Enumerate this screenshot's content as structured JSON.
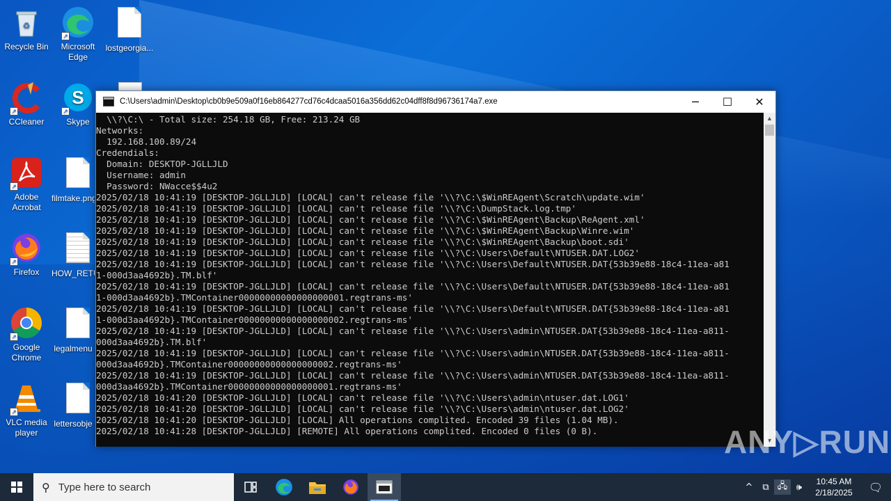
{
  "desktop": {
    "icons": [
      {
        "label": "Recycle Bin",
        "icon": "recycle-bin-icon"
      },
      {
        "label": "Microsoft Edge",
        "icon": "edge-icon"
      },
      {
        "label": "lostgeorgia...",
        "icon": "document-icon"
      },
      {
        "label": "CCleaner",
        "icon": "ccleaner-icon"
      },
      {
        "label": "Skype",
        "icon": "skype-icon"
      },
      {
        "label": "Adobe Acrobat",
        "icon": "acrobat-icon"
      },
      {
        "label": "filmtake.png",
        "icon": "document-icon"
      },
      {
        "label": "Firefox",
        "icon": "firefox-icon"
      },
      {
        "label": "HOW_RETU",
        "icon": "text-document-icon"
      },
      {
        "label": "Google Chrome",
        "icon": "chrome-icon"
      },
      {
        "label": "legalmenu",
        "icon": "document-icon"
      },
      {
        "label": "VLC media player",
        "icon": "vlc-icon"
      },
      {
        "label": "lettersobje",
        "icon": "document-icon"
      }
    ]
  },
  "window": {
    "title": "C:\\Users\\admin\\Desktop\\cb0b9e509a0f16eb864277cd76c4dcaa5016a356dd62c04dff8f8d96736174a7.exe",
    "minimize_glyph": "─",
    "maximize_glyph": "☐",
    "close_glyph": "✕"
  },
  "console": {
    "lines": [
      "  \\\\?\\C:\\ - Total size: 254.18 GB, Free: 213.24 GB",
      "Networks:",
      "  192.168.100.89/24",
      "Credendials:",
      "  Domain: DESKTOP-JGLLJLD",
      "  Username: admin",
      "  Password: NWacce$$4u2",
      "2025/02/18 10:41:19 [DESKTOP-JGLLJLD] [LOCAL] can't release file '\\\\?\\C:\\$WinREAgent\\Scratch\\update.wim'",
      "2025/02/18 10:41:19 [DESKTOP-JGLLJLD] [LOCAL] can't release file '\\\\?\\C:\\DumpStack.log.tmp'",
      "2025/02/18 10:41:19 [DESKTOP-JGLLJLD] [LOCAL] can't release file '\\\\?\\C:\\$WinREAgent\\Backup\\ReAgent.xml'",
      "2025/02/18 10:41:19 [DESKTOP-JGLLJLD] [LOCAL] can't release file '\\\\?\\C:\\$WinREAgent\\Backup\\Winre.wim'",
      "2025/02/18 10:41:19 [DESKTOP-JGLLJLD] [LOCAL] can't release file '\\\\?\\C:\\$WinREAgent\\Backup\\boot.sdi'",
      "2025/02/18 10:41:19 [DESKTOP-JGLLJLD] [LOCAL] can't release file '\\\\?\\C:\\Users\\Default\\NTUSER.DAT.LOG2'",
      "2025/02/18 10:41:19 [DESKTOP-JGLLJLD] [LOCAL] can't release file '\\\\?\\C:\\Users\\Default\\NTUSER.DAT{53b39e88-18c4-11ea-a81",
      "1-000d3aa4692b}.TM.blf'",
      "2025/02/18 10:41:19 [DESKTOP-JGLLJLD] [LOCAL] can't release file '\\\\?\\C:\\Users\\Default\\NTUSER.DAT{53b39e88-18c4-11ea-a81",
      "1-000d3aa4692b}.TMContainer00000000000000000001.regtrans-ms'",
      "2025/02/18 10:41:19 [DESKTOP-JGLLJLD] [LOCAL] can't release file '\\\\?\\C:\\Users\\Default\\NTUSER.DAT{53b39e88-18c4-11ea-a81",
      "1-000d3aa4692b}.TMContainer00000000000000000002.regtrans-ms'",
      "2025/02/18 10:41:19 [DESKTOP-JGLLJLD] [LOCAL] can't release file '\\\\?\\C:\\Users\\admin\\NTUSER.DAT{53b39e88-18c4-11ea-a811-",
      "000d3aa4692b}.TM.blf'",
      "2025/02/18 10:41:19 [DESKTOP-JGLLJLD] [LOCAL] can't release file '\\\\?\\C:\\Users\\admin\\NTUSER.DAT{53b39e88-18c4-11ea-a811-",
      "000d3aa4692b}.TMContainer00000000000000000002.regtrans-ms'",
      "2025/02/18 10:41:19 [DESKTOP-JGLLJLD] [LOCAL] can't release file '\\\\?\\C:\\Users\\admin\\NTUSER.DAT{53b39e88-18c4-11ea-a811-",
      "000d3aa4692b}.TMContainer00000000000000000001.regtrans-ms'",
      "2025/02/18 10:41:20 [DESKTOP-JGLLJLD] [LOCAL] can't release file '\\\\?\\C:\\Users\\admin\\ntuser.dat.LOG1'",
      "2025/02/18 10:41:20 [DESKTOP-JGLLJLD] [LOCAL] can't release file '\\\\?\\C:\\Users\\admin\\ntuser.dat.LOG2'",
      "2025/02/18 10:41:20 [DESKTOP-JGLLJLD] [LOCAL] All operations complited. Encoded 39 files (1.04 MB).",
      "2025/02/18 10:41:28 [DESKTOP-JGLLJLD] [REMOTE] All operations complited. Encoded 0 files (0 B)."
    ]
  },
  "watermark": "ANY▷RUN",
  "taskbar": {
    "search_placeholder": "Type here to search",
    "apps": [
      "task-view-icon",
      "edge-icon",
      "file-explorer-icon",
      "firefox-icon",
      "console-app-icon"
    ],
    "tray": {
      "chevron": "^",
      "time": "10:45 AM",
      "date": "2/18/2025",
      "notification_glyph": "🗨"
    }
  }
}
